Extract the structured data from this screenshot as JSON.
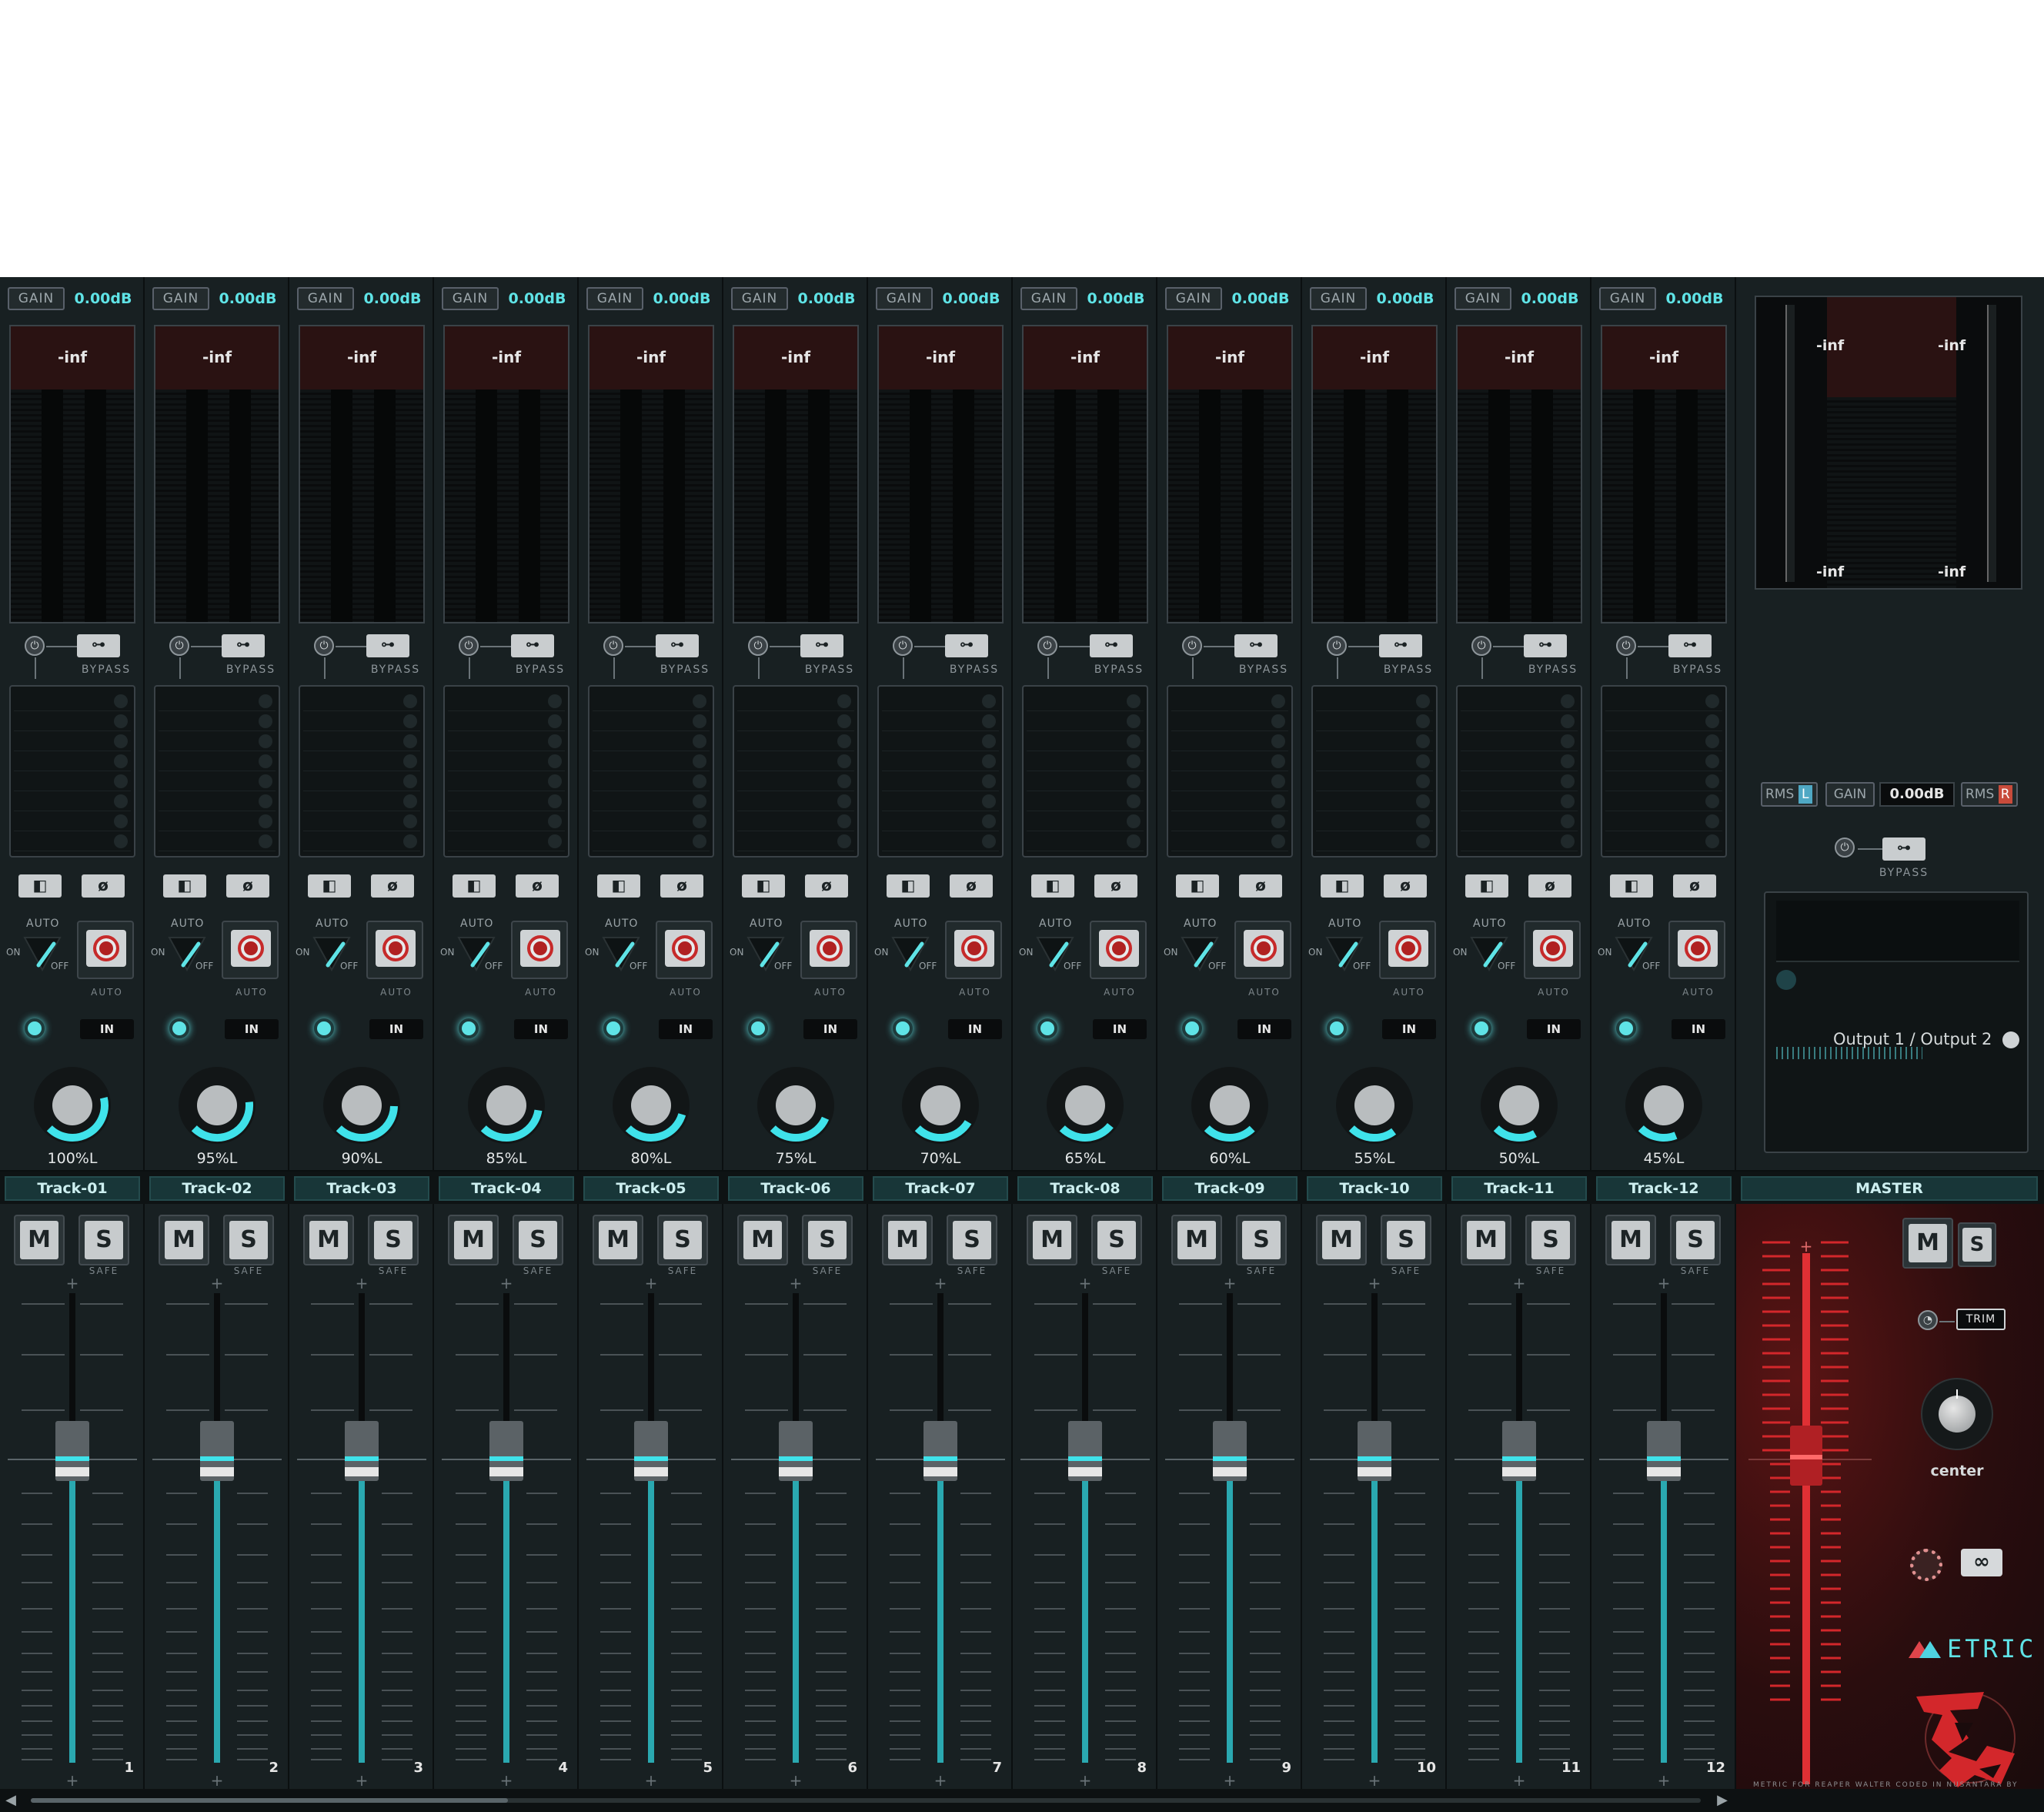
{
  "tracks": [
    {
      "num": "1",
      "name": "Track-01",
      "gain_label": "GAIN",
      "gain_value": "0.00dB",
      "peak": "-inf",
      "bypass_label": "BYPASS",
      "auto_label": "AUTO",
      "on_label": "ON",
      "off_label": "OFF",
      "rec_auto_label": "AUTO",
      "in_label": "IN",
      "pan": "100%L",
      "pan_fraction": 1.0,
      "mute_label": "M",
      "solo_label": "S",
      "safe_label": "SAFE"
    },
    {
      "num": "2",
      "name": "Track-02",
      "gain_label": "GAIN",
      "gain_value": "0.00dB",
      "peak": "-inf",
      "bypass_label": "BYPASS",
      "auto_label": "AUTO",
      "on_label": "ON",
      "off_label": "OFF",
      "rec_auto_label": "AUTO",
      "in_label": "IN",
      "pan": "95%L",
      "pan_fraction": 0.95,
      "mute_label": "M",
      "solo_label": "S",
      "safe_label": "SAFE"
    },
    {
      "num": "3",
      "name": "Track-03",
      "gain_label": "GAIN",
      "gain_value": "0.00dB",
      "peak": "-inf",
      "bypass_label": "BYPASS",
      "auto_label": "AUTO",
      "on_label": "ON",
      "off_label": "OFF",
      "rec_auto_label": "AUTO",
      "in_label": "IN",
      "pan": "90%L",
      "pan_fraction": 0.9,
      "mute_label": "M",
      "solo_label": "S",
      "safe_label": "SAFE"
    },
    {
      "num": "4",
      "name": "Track-04",
      "gain_label": "GAIN",
      "gain_value": "0.00dB",
      "peak": "-inf",
      "bypass_label": "BYPASS",
      "auto_label": "AUTO",
      "on_label": "ON",
      "off_label": "OFF",
      "rec_auto_label": "AUTO",
      "in_label": "IN",
      "pan": "85%L",
      "pan_fraction": 0.85,
      "mute_label": "M",
      "solo_label": "S",
      "safe_label": "SAFE"
    },
    {
      "num": "5",
      "name": "Track-05",
      "gain_label": "GAIN",
      "gain_value": "0.00dB",
      "peak": "-inf",
      "bypass_label": "BYPASS",
      "auto_label": "AUTO",
      "on_label": "ON",
      "off_label": "OFF",
      "rec_auto_label": "AUTO",
      "in_label": "IN",
      "pan": "80%L",
      "pan_fraction": 0.8,
      "mute_label": "M",
      "solo_label": "S",
      "safe_label": "SAFE"
    },
    {
      "num": "6",
      "name": "Track-06",
      "gain_label": "GAIN",
      "gain_value": "0.00dB",
      "peak": "-inf",
      "bypass_label": "BYPASS",
      "auto_label": "AUTO",
      "on_label": "ON",
      "off_label": "OFF",
      "rec_auto_label": "AUTO",
      "in_label": "IN",
      "pan": "75%L",
      "pan_fraction": 0.75,
      "mute_label": "M",
      "solo_label": "S",
      "safe_label": "SAFE"
    },
    {
      "num": "7",
      "name": "Track-07",
      "gain_label": "GAIN",
      "gain_value": "0.00dB",
      "peak": "-inf",
      "bypass_label": "BYPASS",
      "auto_label": "AUTO",
      "on_label": "ON",
      "off_label": "OFF",
      "rec_auto_label": "AUTO",
      "in_label": "IN",
      "pan": "70%L",
      "pan_fraction": 0.7,
      "mute_label": "M",
      "solo_label": "S",
      "safe_label": "SAFE"
    },
    {
      "num": "8",
      "name": "Track-08",
      "gain_label": "GAIN",
      "gain_value": "0.00dB",
      "peak": "-inf",
      "bypass_label": "BYPASS",
      "auto_label": "AUTO",
      "on_label": "ON",
      "off_label": "OFF",
      "rec_auto_label": "AUTO",
      "in_label": "IN",
      "pan": "65%L",
      "pan_fraction": 0.65,
      "mute_label": "M",
      "solo_label": "S",
      "safe_label": "SAFE"
    },
    {
      "num": "9",
      "name": "Track-09",
      "gain_label": "GAIN",
      "gain_value": "0.00dB",
      "peak": "-inf",
      "bypass_label": "BYPASS",
      "auto_label": "AUTO",
      "on_label": "ON",
      "off_label": "OFF",
      "rec_auto_label": "AUTO",
      "in_label": "IN",
      "pan": "60%L",
      "pan_fraction": 0.6,
      "mute_label": "M",
      "solo_label": "S",
      "safe_label": "SAFE"
    },
    {
      "num": "10",
      "name": "Track-10",
      "gain_label": "GAIN",
      "gain_value": "0.00dB",
      "peak": "-inf",
      "bypass_label": "BYPASS",
      "auto_label": "AUTO",
      "on_label": "ON",
      "off_label": "OFF",
      "rec_auto_label": "AUTO",
      "in_label": "IN",
      "pan": "55%L",
      "pan_fraction": 0.55,
      "mute_label": "M",
      "solo_label": "S",
      "safe_label": "SAFE"
    },
    {
      "num": "11",
      "name": "Track-11",
      "gain_label": "GAIN",
      "gain_value": "0.00dB",
      "peak": "-inf",
      "bypass_label": "BYPASS",
      "auto_label": "AUTO",
      "on_label": "ON",
      "off_label": "OFF",
      "rec_auto_label": "AUTO",
      "in_label": "IN",
      "pan": "50%L",
      "pan_fraction": 0.5,
      "mute_label": "M",
      "solo_label": "S",
      "safe_label": "SAFE"
    },
    {
      "num": "12",
      "name": "Track-12",
      "gain_label": "GAIN",
      "gain_value": "0.00dB",
      "peak": "-inf",
      "bypass_label": "BYPASS",
      "auto_label": "AUTO",
      "on_label": "ON",
      "off_label": "OFF",
      "rec_auto_label": "AUTO",
      "in_label": "IN",
      "pan": "45%L",
      "pan_fraction": 0.45,
      "mute_label": "M",
      "solo_label": "S",
      "safe_label": "SAFE"
    }
  ],
  "master": {
    "name": "MASTER",
    "peak_left_top": "-inf",
    "peak_right_top": "-inf",
    "peak_left_bottom": "-inf",
    "peak_right_bottom": "-inf",
    "rms_label": "RMS",
    "left_label": "L",
    "right_label": "R",
    "gain_label": "GAIN",
    "gain_value": "0.00dB",
    "bypass_label": "BYPASS",
    "output_label": "Output 1 / Output 2",
    "mute_label": "M",
    "solo_label": "S",
    "trim_label": "TRIM",
    "pan_label": "center",
    "logo_text": "ETRIC",
    "credit": "METRIC FOR REAPER WALTER CODED IN NUSANTARA BY JUBILANT RESEARCH OF ECLECTIC NOVELTY GENERATOR"
  },
  "icons": {
    "fx_toggle": "power-icon",
    "bypass": "switch-icon",
    "phase": "phase-invert-icon",
    "input_monitor": "speaker-icon",
    "record": "record-icon",
    "link": "link-icon",
    "settings": "gear-icon",
    "scroll_left": "arrow-left-icon",
    "scroll_right": "arrow-right-icon"
  },
  "colors": {
    "accent": "#5fe3e6",
    "background": "#161d1f",
    "strip": "#182022",
    "master_red": "#d3272b",
    "record": "#c62a2a"
  }
}
